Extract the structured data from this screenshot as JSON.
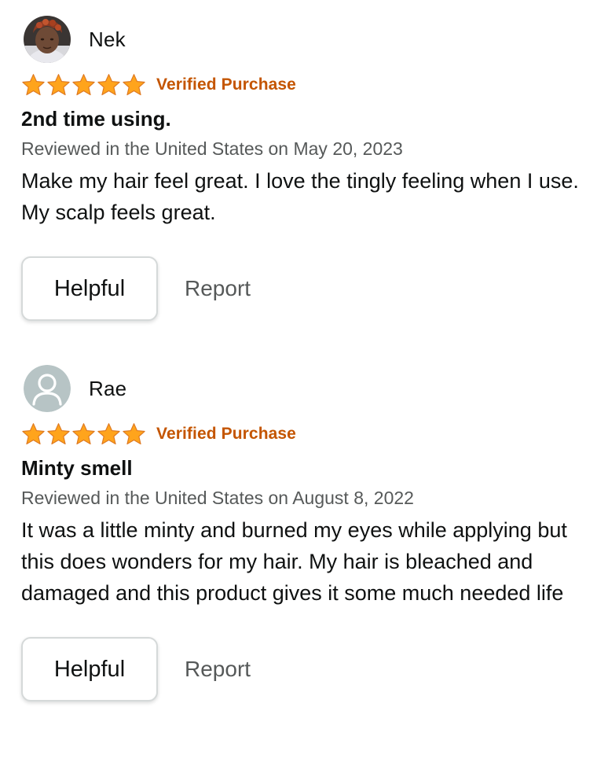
{
  "colors": {
    "star": "#ffa41c",
    "verified": "#c45500",
    "secondary_text": "#565959"
  },
  "reviews": [
    {
      "author": "Nek",
      "rating": 5,
      "max_rating": 5,
      "verified": "Verified Purchase",
      "title": "2nd time using.",
      "date": "Reviewed in the United States on May 20, 2023",
      "body": "Make my hair feel great. I love the tingly feeling when I use. My scalp feels great.",
      "helpful_label": "Helpful",
      "report_label": "Report",
      "avatar": "user-photo"
    },
    {
      "author": "Rae",
      "rating": 5,
      "max_rating": 5,
      "verified": "Verified Purchase",
      "title": "Minty smell",
      "date": "Reviewed in the United States on August 8, 2022",
      "body": "It was a little minty and burned my eyes while applying but this does wonders for my hair. My hair is bleached and damaged and this product gives it some much needed life",
      "helpful_label": "Helpful",
      "report_label": "Report",
      "avatar": "default-user-icon"
    }
  ]
}
